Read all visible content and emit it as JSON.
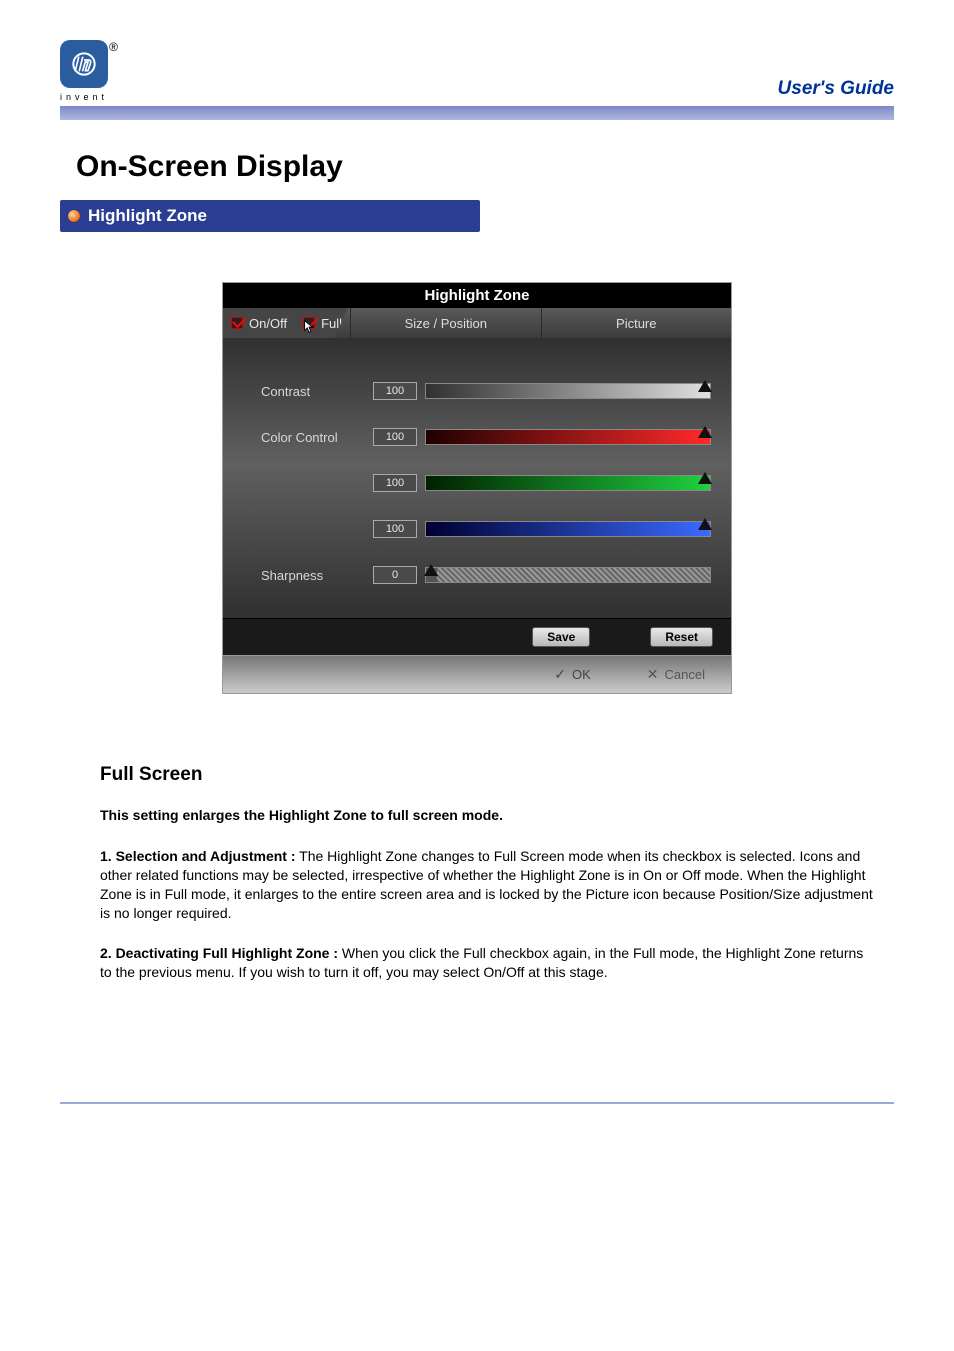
{
  "header": {
    "logo_text": "invent",
    "guide_label": "User's Guide"
  },
  "page_title": "On-Screen Display",
  "section_header": "Highlight Zone",
  "osd": {
    "title": "Highlight Zone",
    "checkbox_onoff": "On/Off",
    "checkbox_full": "Full",
    "tab_size": "Size / Position",
    "tab_picture": "Picture",
    "rows": {
      "contrast": {
        "label": "Contrast",
        "value": "100"
      },
      "color": {
        "label": "Color Control",
        "value": "100"
      },
      "green": {
        "label": "",
        "value": "100"
      },
      "blue": {
        "label": "",
        "value": "100"
      },
      "sharpness": {
        "label": "Sharpness",
        "value": "0"
      }
    },
    "save": "Save",
    "reset": "Reset",
    "ok": "OK",
    "cancel": "Cancel"
  },
  "content": {
    "subhead": "Full Screen",
    "lead": "This setting enlarges the Highlight Zone to full screen mode.",
    "p1_label": "1. Selection and Adjustment :",
    "p1_body": " The Highlight Zone changes to Full Screen mode when its checkbox is selected. Icons and other related functions may be selected, irrespective of whether the Highlight Zone is in On or Off mode. When the Highlight Zone is in Full mode, it enlarges to the entire screen area and is locked by the Picture icon because Position/Size adjustment is no longer required.",
    "p2_label": "2. Deactivating Full Highlight Zone :",
    "p2_body": " When you click the Full checkbox again, in the Full mode, the Highlight Zone returns to the previous menu. If you wish to turn it off, you may select On/Off at this stage."
  }
}
